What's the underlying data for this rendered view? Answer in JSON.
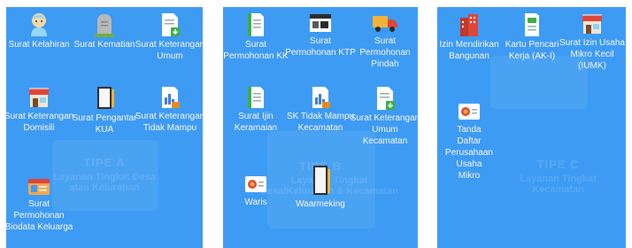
{
  "panels": [
    {
      "watermark": {
        "type": "TIPE A",
        "subtitle": "Layanan Tingkat Desa atau Kelurahan"
      },
      "items": [
        {
          "label": "Surat Kelahiran",
          "icon": "baby-icon"
        },
        {
          "label": "Surat Kematian",
          "icon": "tombstone-icon"
        },
        {
          "label": "Surat Keterangan Umum",
          "icon": "document-download-icon"
        },
        {
          "label": "Surat Keterangan Domisili",
          "icon": "shop-icon"
        },
        {
          "label": "Surat Pengantar KUA",
          "icon": "notebook-icon"
        },
        {
          "label": "Surat Keterangan Tidak Mampu",
          "icon": "chart-document-icon"
        },
        {
          "label": "Surat Permohonan Biodata Keluarga",
          "icon": "id-card-icon"
        }
      ]
    },
    {
      "watermark": {
        "type": "TIPE B",
        "subtitle": "Layanan Tingkat Desa/Kelurahan & Kecamatan"
      },
      "items": [
        {
          "label": "Surat Permohonan KK",
          "icon": "document-list-icon"
        },
        {
          "label": "Surat Permohonan KTP",
          "icon": "id-card-window-icon"
        },
        {
          "label": "Surat Permohonan Pindah",
          "icon": "moving-truck-icon"
        },
        {
          "label": "Surat Ijin Keramaian",
          "icon": "document-list-icon"
        },
        {
          "label": "SK Tidak Mampu Kecamatan",
          "icon": "chart-document-icon"
        },
        {
          "label": "Surat Keterangan Umum Kecamatan",
          "icon": "document-download-icon"
        },
        {
          "label": "Waris",
          "icon": "certificate-icon"
        },
        {
          "label": "Waarmeking",
          "icon": "notebook-icon"
        }
      ]
    },
    {
      "watermark": {
        "type": "TIPE C",
        "subtitle": "Layanan Tingkat Kecamatan"
      },
      "items": [
        {
          "label": "Izin Mendirikan Bangunan",
          "icon": "building-icon"
        },
        {
          "label": "Kartu Pencari Kerja (AK-I)",
          "icon": "document-list-icon"
        },
        {
          "label": "Surat Izin Usaha Mikro Kecil (IUMK)",
          "icon": "shop-icon"
        },
        {
          "label": "Tanda Daftar Perusahaan Usaha Mikro",
          "icon": "certificate-icon"
        }
      ]
    }
  ],
  "colors": {
    "panel": "#3d9bf3",
    "label": "#ffffff"
  }
}
